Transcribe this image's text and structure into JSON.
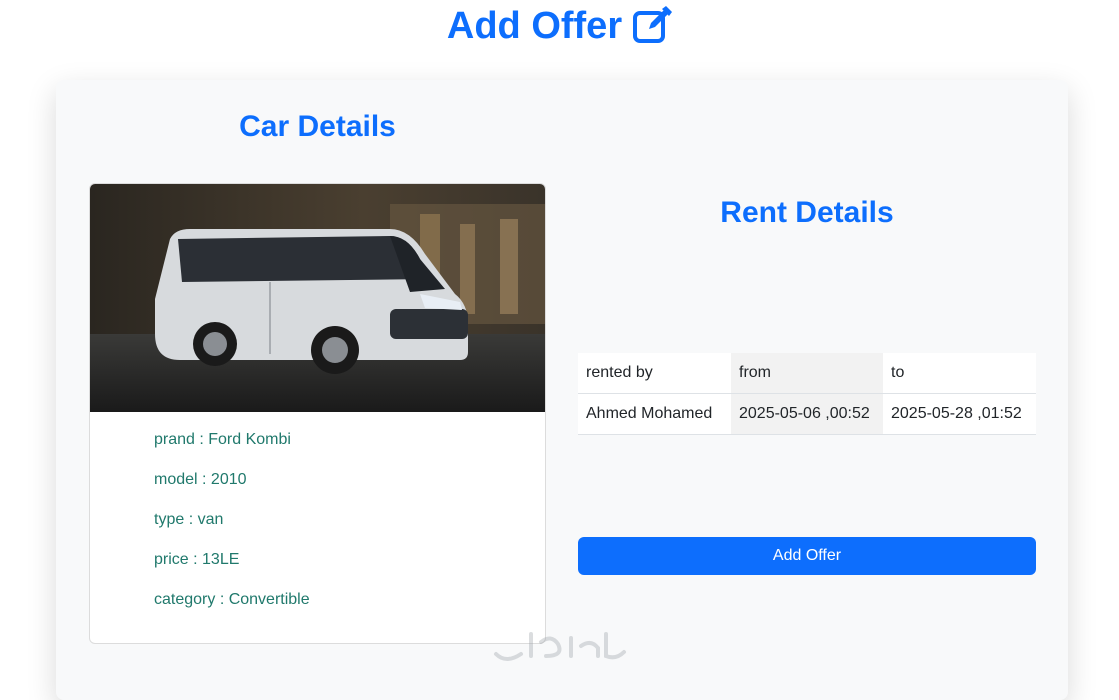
{
  "page": {
    "title": "Add Offer",
    "title_icon": "edit-icon"
  },
  "car": {
    "heading": "Car Details",
    "image_alt": "car-photo",
    "details": [
      {
        "text": "prand : Ford Kombi"
      },
      {
        "text": "model : 2010"
      },
      {
        "text": "type : van"
      },
      {
        "text": "price : 13LE"
      },
      {
        "text": "category : Convertible"
      }
    ]
  },
  "rent": {
    "heading": "Rent Details",
    "headers": [
      "rented by",
      "from",
      "to"
    ],
    "rows": [
      [
        "Ahmed Mohamed",
        "2025-05-06 ,00:52",
        "2025-05-28 ,01:52"
      ]
    ]
  },
  "actions": {
    "add_offer_label": "Add Offer"
  },
  "colors": {
    "accent": "#0d6efd",
    "detail_text": "#20796c",
    "panel_bg": "#f8f9fa"
  }
}
